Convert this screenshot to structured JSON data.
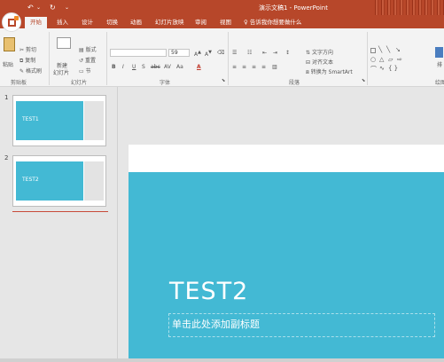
{
  "window": {
    "title": "演示文稿1 - PowerPoint"
  },
  "quick_access": {
    "save_icon": "save-icon",
    "undo_glyph": "↶",
    "redo_glyph": "↻",
    "customize_glyph": "⌄"
  },
  "tabs": [
    {
      "label": "文件"
    },
    {
      "label": "开始"
    },
    {
      "label": "插入"
    },
    {
      "label": "设计"
    },
    {
      "label": "切换"
    },
    {
      "label": "动画"
    },
    {
      "label": "幻灯片放映"
    },
    {
      "label": "审阅"
    },
    {
      "label": "视图"
    }
  ],
  "tell_me": {
    "text": "告诉我你想要做什么"
  },
  "ribbon": {
    "clipboard": {
      "paste": "粘贴",
      "cut": "剪切",
      "copy": "复制",
      "format_painter": "格式刷",
      "label": "剪贴板"
    },
    "slides": {
      "new_slide": "新建",
      "new_slide2": "幻灯片",
      "layout": "版式",
      "reset": "重置",
      "section": "节",
      "label": "幻灯片"
    },
    "font": {
      "size": "59",
      "label": "字体",
      "buttons": [
        "B",
        "I",
        "U",
        "S",
        "abc",
        "AV",
        "Aa",
        "A"
      ]
    },
    "paragraph": {
      "text_direction": "文字方向",
      "align_text": "对齐文本",
      "smartart": "转换为 SmartArt",
      "label": "段落"
    },
    "drawing": {
      "label": "绘图",
      "arrange": "排"
    }
  },
  "thumbnails": [
    {
      "number": "1",
      "text": "TEST1"
    },
    {
      "number": "2",
      "text": "TEST2"
    }
  ],
  "slide": {
    "title": "TEST2",
    "subtitle_placeholder": "单击此处添加副标题"
  },
  "colors": {
    "accent": "#b7472a",
    "slide_blue": "#43b9d4"
  }
}
